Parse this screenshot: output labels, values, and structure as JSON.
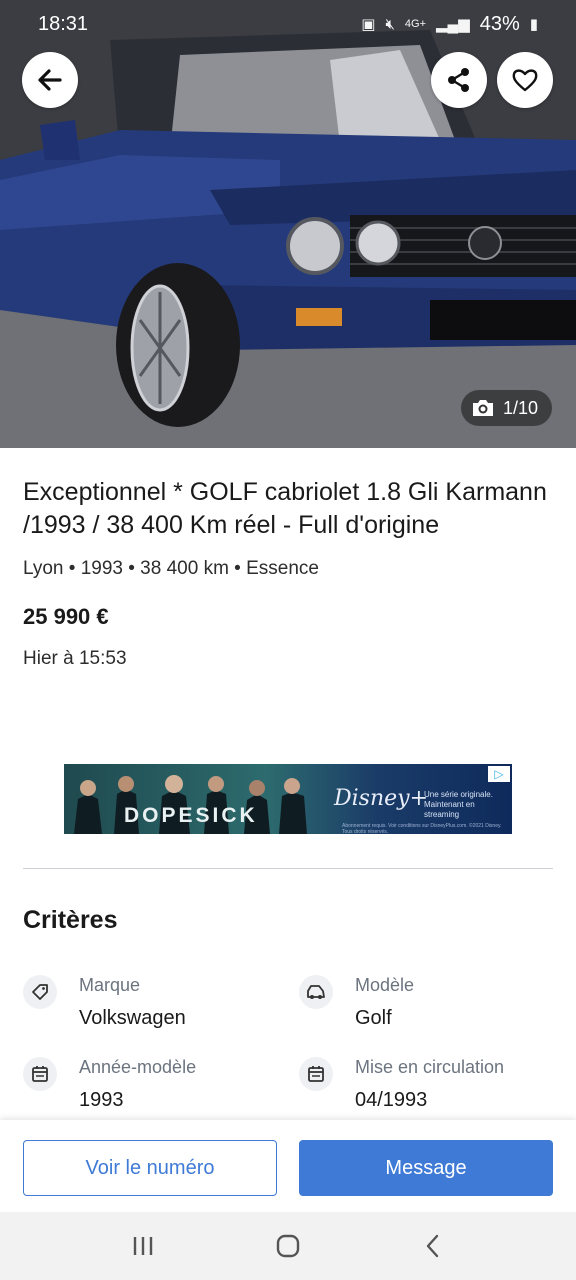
{
  "status_bar": {
    "time": "18:31",
    "network": "4G+",
    "battery": "43%"
  },
  "gallery": {
    "counter": "1/10",
    "icons": {
      "back": "arrow-left-icon",
      "share": "share-icon",
      "favorite": "heart-icon",
      "camera": "camera-icon"
    }
  },
  "listing": {
    "title": "Exceptionnel * GOLF cabriolet 1.8 Gli Karmann /1993 / 38 400 Km réel - Full d'origine",
    "meta": "Lyon • 1993 • 38 400 km • Essence",
    "price": "25 990 €",
    "date": "Hier à 15:53"
  },
  "ad": {
    "show_title": "DOPESICK",
    "brand": "Disney+",
    "tagline": "Une série originale. Maintenant en streaming",
    "fine_print": "Abonnement requis. Voir conditions sur DisneyPlus.com. ©2021 Disney. Tous droits réservés."
  },
  "criteria": {
    "title": "Critères",
    "items": [
      {
        "label": "Marque",
        "value": "Volkswagen",
        "icon": "tag-icon"
      },
      {
        "label": "Modèle",
        "value": "Golf",
        "icon": "car-icon"
      },
      {
        "label": "Année-modèle",
        "value": "1993",
        "icon": "calendar-icon"
      },
      {
        "label": "Mise en circulation",
        "value": "04/1993",
        "icon": "calendar-icon"
      }
    ]
  },
  "actions": {
    "call_label": "Voir le numéro",
    "message_label": "Message"
  },
  "colors": {
    "primary": "#3f7bd6",
    "car_blue": "#253a7a"
  }
}
